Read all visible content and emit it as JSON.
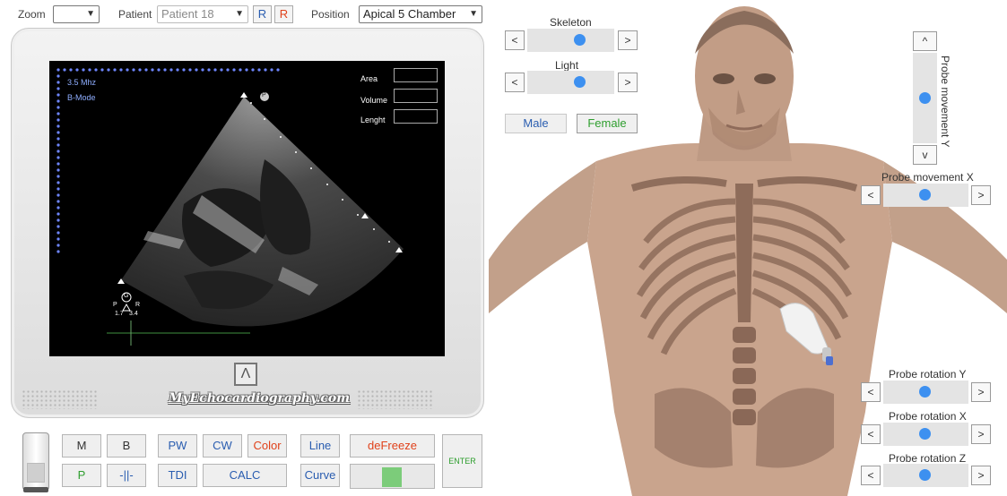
{
  "topbar": {
    "zoom_label": "Zoom",
    "zoom_value": "",
    "patient_label": "Patient",
    "patient_value": "Patient 18",
    "r_label": "R",
    "position_label": "Position",
    "position_value": "Apical 5 Chamber"
  },
  "screen": {
    "frequency": "3.5 Mhz",
    "mode": "B-Mode",
    "area_label": "Area",
    "volume_label": "Volume",
    "length_label": "Lenght",
    "marker_p": "P",
    "marker_g": "G",
    "scale_p": "P",
    "scale_r": "R",
    "scale_left": "1.7",
    "scale_right": "3.4"
  },
  "monitor": {
    "brand": "MyEchocardiography.com"
  },
  "controls": {
    "m": "M",
    "b": "B",
    "pw": "PW",
    "cw": "CW",
    "color": "Color",
    "line": "Line",
    "defreeze": "deFreeze",
    "p": "P",
    "bar": "-||-",
    "tdi": "TDI",
    "calc": "CALC",
    "curve": "Curve",
    "enter": "ENTER"
  },
  "view_controls": {
    "skeleton_label": "Skeleton",
    "light_label": "Light",
    "male_label": "Male",
    "female_label": "Female",
    "probe_y_label": "Probe movement Y",
    "probe_x_label": "Probe movement X",
    "rot_y_label": "Probe rotation Y",
    "rot_x_label": "Probe rotation X",
    "rot_z_label": "Probe rotation Z",
    "left_arrow": "<",
    "right_arrow": ">",
    "up_arrow": "^",
    "down_arrow": "v"
  },
  "colors": {
    "accent": "#3d90f0",
    "green": "#2e9e2e",
    "red": "#e0421b",
    "link_blue": "#2a5db0"
  }
}
